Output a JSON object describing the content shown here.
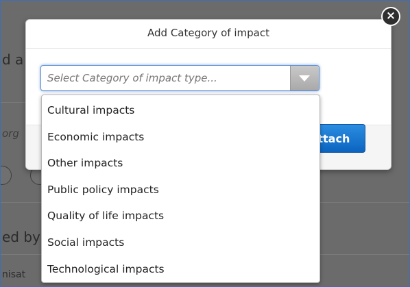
{
  "modal": {
    "title": "Add Category of impact",
    "close_label": "×",
    "attach_label": "Attach"
  },
  "select": {
    "placeholder": "Select Category of impact type...",
    "options": [
      "Cultural impacts",
      "Economic impacts",
      "Other impacts",
      "Public policy impacts",
      "Quality of life impacts",
      "Social impacts",
      "Technological impacts"
    ]
  },
  "background": {
    "fragment_1": "d a",
    "fragment_2": "org",
    "fragment_3": "ed by",
    "fragment_4": "nisat"
  },
  "colors": {
    "accent": "#1f7fd3",
    "focus_border": "#5b8fd6"
  }
}
